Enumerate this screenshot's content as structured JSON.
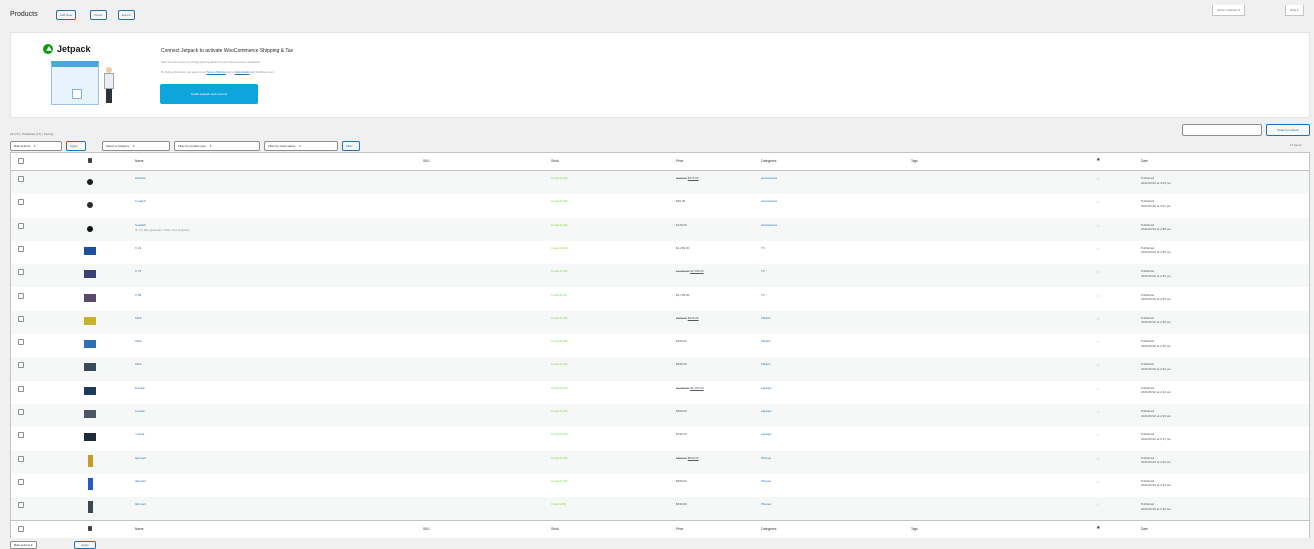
{
  "header": {
    "title": "Products",
    "actions": [
      "Add New",
      "Import",
      "Export"
    ],
    "screen_options": "Screen Options",
    "help": "Help"
  },
  "banner": {
    "logo_text": "Jetpack",
    "title": "Connect Jetpack to activate WooCommerce Shipping & Tax",
    "line1": "Save time and money by printing shipping labels from your WooCommerce dashboard.",
    "line2_prefix": "By clicking the button, you agree to our",
    "line2_link1": "Terms of Service",
    "line2_mid": "and to",
    "line2_link2": "share details",
    "line2_suffix": "with WordPress.com.",
    "button": "Install Jetpack and connect"
  },
  "subsubsub": "All (17) | Published (17) | Sorting",
  "filters": {
    "bulk_actions": "Bulk actions",
    "apply": "Apply",
    "category": "Select a category",
    "product_type": "Filter by product type",
    "stock_status": "Filter by stock status",
    "filter_btn": "Filter"
  },
  "search": {
    "button": "Search products"
  },
  "items_count": "17 items",
  "columns": {
    "name": "Name",
    "sku": "SKU",
    "stock": "Stock",
    "price": "Price",
    "categories": "Categories",
    "tags": "Tags",
    "featured": "★",
    "date": "Date"
  },
  "rows": [
    {
      "thumb": "#1d1d1f",
      "thumb_type": "dot",
      "name": "AirPods",
      "sub": "",
      "stock": "In stock (12)",
      "price_old": "$199.00",
      "price_new": "$179.00",
      "cat": "Accessories",
      "date1": "Published",
      "date2": "2021/06/10 at 3:04 pm"
    },
    {
      "thumb": "#2a2a2a",
      "thumb_type": "dot",
      "name": "T-watch",
      "sub": "",
      "stock": "In stock (30)",
      "price_old": "",
      "price_new": "$99.00",
      "cat": "Accessories",
      "date1": "Published",
      "date2": "2021/06/10 at 3:01 pm"
    },
    {
      "thumb": "#111111",
      "thumb_type": "dot",
      "name": "S-watch",
      "sub": "ID: 73 | Edit | Quick Edit | Trash | View | Duplicate",
      "stock": "In stock (40)",
      "price_old": "",
      "price_new": "$149.00",
      "cat": "Accessories",
      "date1": "Published",
      "date2": "2021/06/10 at 2:58 pm"
    },
    {
      "thumb": "#1f4e9c",
      "thumb_type": "laptop",
      "name": "X 24",
      "sub": "",
      "stock": "In stock (10)",
      "price_old": "",
      "price_new": "$1,299.00",
      "cat": "TV",
      "date1": "Published",
      "date2": "2021/06/10 at 2:55 pm"
    },
    {
      "thumb": "#3a3f7a",
      "thumb_type": "laptop",
      "name": "X 75",
      "sub": "",
      "stock": "In stock (15)",
      "price_old": "$2,999.00",
      "price_new": "$2,499.00",
      "cat": "TV",
      "date1": "Published",
      "date2": "2021/06/10 at 2:53 pm"
    },
    {
      "thumb": "#5a4a6a",
      "thumb_type": "laptop",
      "name": "X 55",
      "sub": "",
      "stock": "In stock (11)",
      "price_old": "",
      "price_new": "$1,799.00",
      "cat": "TV",
      "date1": "Published",
      "date2": "2021/06/10 at 2:50 pm"
    },
    {
      "thumb": "#c9b030",
      "thumb_type": "laptop",
      "name": "Tab3",
      "sub": "",
      "stock": "In stock (45)",
      "price_old": "$499.00",
      "price_new": "$449.00",
      "cat": "Tablets",
      "date1": "Published",
      "date2": "2021/06/10 at 2:48 pm"
    },
    {
      "thumb": "#2f6db5",
      "thumb_type": "laptop",
      "name": "Tab2",
      "sub": "",
      "stock": "In stock (38)",
      "price_old": "",
      "price_new": "$399.00",
      "cat": "Tablets",
      "date1": "Published",
      "date2": "2021/06/10 at 2:46 pm"
    },
    {
      "thumb": "#394a5c",
      "thumb_type": "laptop",
      "name": "Tab1",
      "sub": "",
      "stock": "In stock (21)",
      "price_old": "",
      "price_new": "$299.00",
      "cat": "Tablets",
      "date1": "Published",
      "date2": "2021/06/10 at 2:44 pm"
    },
    {
      "thumb": "#1c3a5a",
      "thumb_type": "laptop",
      "name": "D-book",
      "sub": "",
      "stock": "In stock (14)",
      "price_old": "$1,499.00",
      "price_new": "$1,299.00",
      "cat": "Laptops",
      "date1": "Published",
      "date2": "2021/06/10 at 2:41 pm"
    },
    {
      "thumb": "#4d5563",
      "thumb_type": "laptop",
      "name": "C-book",
      "sub": "",
      "stock": "In stock (19)",
      "price_old": "",
      "price_new": "$999.00",
      "cat": "Laptops",
      "date1": "Published",
      "date2": "2021/06/10 at 2:39 pm"
    },
    {
      "thumb": "#1e2b3b",
      "thumb_type": "laptop",
      "name": "Y-book",
      "sub": "",
      "stock": "In stock (23)",
      "price_old": "",
      "price_new": "$799.00",
      "cat": "Laptops",
      "date1": "Published",
      "date2": "2021/06/10 at 2:37 pm"
    },
    {
      "thumb": "#c79a2a",
      "thumb_type": "phone",
      "name": "Iphone3",
      "sub": "",
      "stock": "In stock (60)",
      "price_old": "$899.00",
      "price_new": "$849.00",
      "cat": "Phones",
      "date1": "Published",
      "date2": "2021/06/10 at 2:35 pm"
    },
    {
      "thumb": "#2a58c8",
      "thumb_type": "phone",
      "name": "Iphone2",
      "sub": "",
      "stock": "In stock (70)",
      "price_old": "",
      "price_new": "$699.00",
      "cat": "Phones",
      "date1": "Published",
      "date2": "2021/06/10 at 2:33 pm"
    },
    {
      "thumb": "#3d4750",
      "thumb_type": "phone",
      "name": "Iphone1",
      "sub": "",
      "stock": "In stock (8)",
      "price_old": "",
      "price_new": "$499.00",
      "cat": "Phones",
      "date1": "Published",
      "date2": "2021/06/10 at 2:30 pm"
    }
  ],
  "bottom": {
    "bulk_actions": "Bulk actions",
    "apply": "Apply"
  }
}
